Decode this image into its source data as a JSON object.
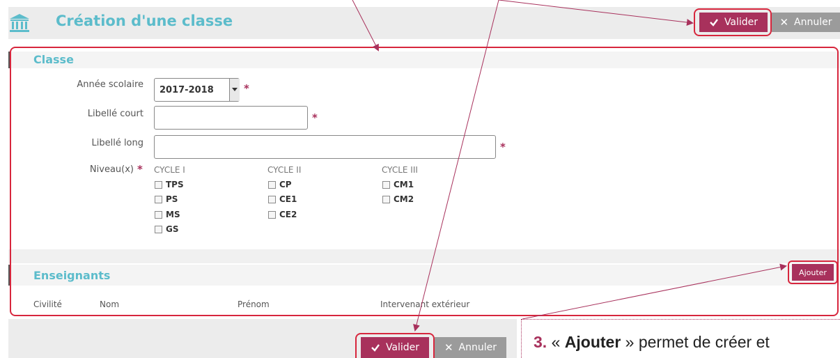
{
  "header": {
    "title": "Création d'une classe",
    "validate_label": "Valider",
    "cancel_label": "Annuler"
  },
  "classe": {
    "section_title": "Classe",
    "annee": {
      "label": "Année scolaire",
      "value": "2017-2018"
    },
    "libelle_court": {
      "label": "Libellé court",
      "value": ""
    },
    "libelle_long": {
      "label": "Libellé long",
      "value": ""
    },
    "niveaux": {
      "label": "Niveau(x)",
      "cycles": [
        {
          "name": "CYCLE I",
          "levels": [
            "TPS",
            "PS",
            "MS",
            "GS"
          ]
        },
        {
          "name": "CYCLE II",
          "levels": [
            "CP",
            "CE1",
            "CE2"
          ]
        },
        {
          "name": "CYCLE III",
          "levels": [
            "CM1",
            "CM2"
          ]
        }
      ]
    },
    "required_mark": "*"
  },
  "enseignants": {
    "section_title": "Enseignants",
    "add_label": "Ajouter",
    "columns": [
      "Civilité",
      "Nom",
      "Prénom",
      "Intervenant extérieur"
    ]
  },
  "footer": {
    "validate_label": "Valider",
    "cancel_label": "Annuler"
  },
  "callout": {
    "number": "3.",
    "open_quote": "« ",
    "strong": "Ajouter",
    "rest": " » permet de créer et"
  },
  "colors": {
    "accent": "#a8315c",
    "title": "#5cbccb",
    "annotation": "#d7263d"
  }
}
